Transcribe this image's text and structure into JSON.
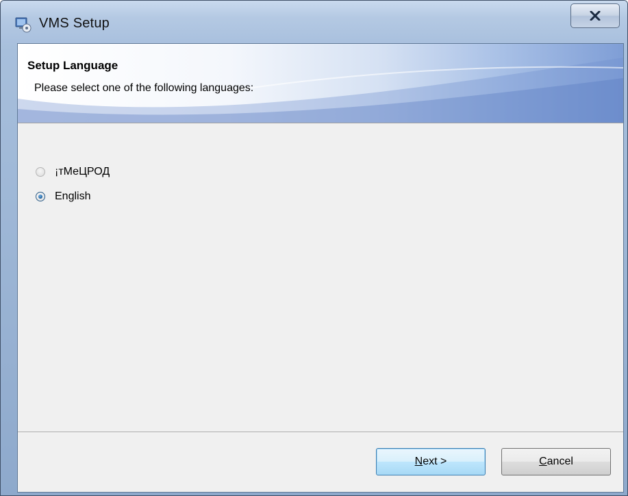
{
  "window": {
    "title": "VMS Setup",
    "app_icon": "setup-installer-icon",
    "close_glyph": "✕"
  },
  "banner": {
    "heading": "Setup Language",
    "subheading": "Please select one of the following languages:"
  },
  "languages": [
    {
      "label": "¡тМеЦРОД",
      "checked": false,
      "enabled": false
    },
    {
      "label": "English",
      "checked": true,
      "enabled": true
    }
  ],
  "buttons": {
    "next": {
      "mnemonic": "N",
      "rest": "ext >"
    },
    "cancel": {
      "mnemonic": "C",
      "rest": "ancel"
    }
  },
  "colors": {
    "title_bar": "#b4c9e3",
    "banner_gradient_end": "#7f9ed6",
    "client_background": "#f0f0f0",
    "default_button_border": "#3c7fb1"
  }
}
